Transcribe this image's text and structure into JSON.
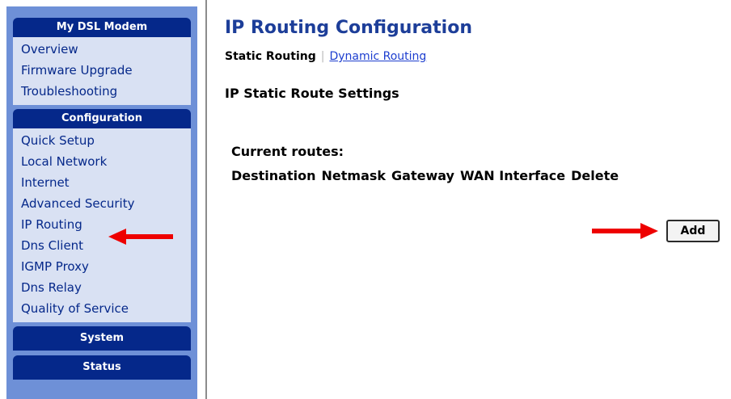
{
  "sidebar": {
    "groups": [
      {
        "header": "My DSL Modem",
        "items": [
          "Overview",
          "Firmware Upgrade",
          "Troubleshooting"
        ]
      },
      {
        "header": "Configuration",
        "items": [
          "Quick Setup",
          "Local Network",
          "Internet",
          "Advanced Security",
          "IP Routing",
          "Dns Client",
          "IGMP Proxy",
          "Dns Relay",
          "Quality of Service"
        ]
      },
      {
        "header": "System"
      },
      {
        "header": "Status"
      }
    ]
  },
  "main": {
    "title": "IP Routing Configuration",
    "tabs": [
      {
        "label": "Static Routing",
        "active": true
      },
      {
        "label": "Dynamic Routing",
        "active": false
      }
    ],
    "tab_separator": "|",
    "section_heading": "IP Static Route Settings",
    "routes_label": "Current routes:",
    "columns": [
      "Destination",
      "Netmask",
      "Gateway",
      "WAN Interface",
      "Delete"
    ],
    "add_label": "Add"
  },
  "annotations": [
    {
      "name": "red-arrow-icon",
      "target": "sidebar IP Routing",
      "color": "#ee0000"
    },
    {
      "name": "red-arrow-icon",
      "target": "Add button",
      "color": "#ee0000"
    }
  ],
  "colors": {
    "sidebar_bg": "#6e90d7",
    "header_bg": "#05288a",
    "items_bg": "#d9e1f3",
    "link": "#1d3ecf",
    "title": "#1d3e99"
  }
}
